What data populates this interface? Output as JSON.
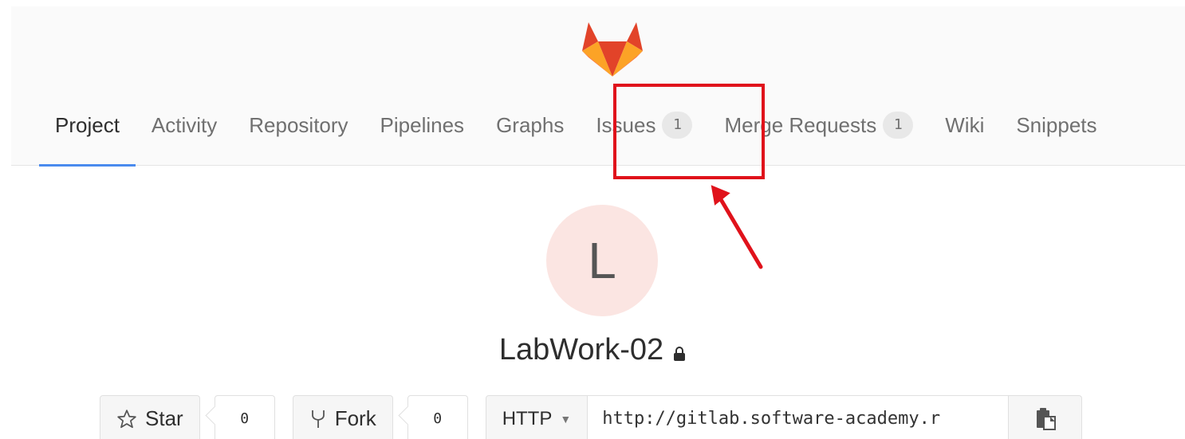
{
  "nav": {
    "items": [
      {
        "label": "Project",
        "active": true
      },
      {
        "label": "Activity"
      },
      {
        "label": "Repository"
      },
      {
        "label": "Pipelines"
      },
      {
        "label": "Graphs"
      },
      {
        "label": "Issues",
        "badge": "1"
      },
      {
        "label": "Merge Requests",
        "badge": "1"
      },
      {
        "label": "Wiki"
      },
      {
        "label": "Snippets"
      }
    ]
  },
  "project": {
    "avatar_letter": "L",
    "name": "LabWork-02"
  },
  "actions": {
    "star_label": "Star",
    "star_count": "0",
    "fork_label": "Fork",
    "fork_count": "0",
    "protocol": "HTTP",
    "clone_url": "http://gitlab.software-academy.r"
  },
  "icons": {
    "logo": "gitlab-fox-logo",
    "lock": "lock-icon",
    "star": "star-outline-icon",
    "fork": "fork-icon",
    "copy": "clipboard-icon"
  },
  "colors": {
    "active_tab": "#4a8bee",
    "highlight": "#e0121b",
    "avatar_bg": "#fbe5e2"
  }
}
